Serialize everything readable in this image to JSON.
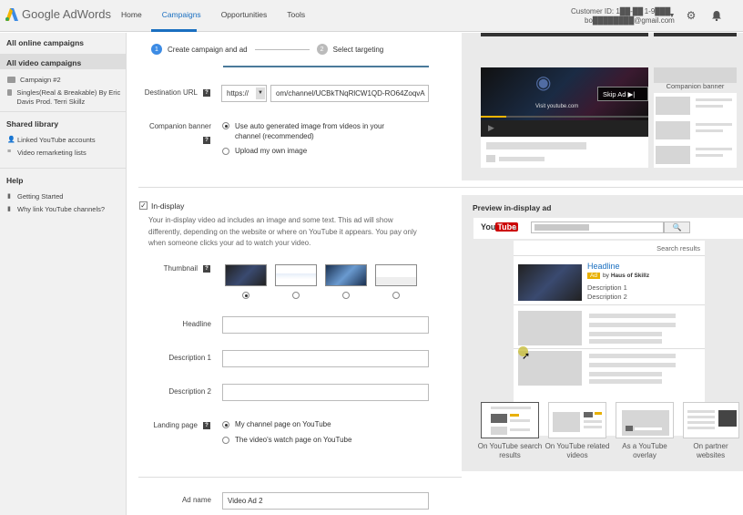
{
  "header": {
    "logo_text": "Google AdWords",
    "nav": [
      "Home",
      "Campaigns",
      "Opportunities",
      "Tools"
    ],
    "customer_id": "Customer ID: 1██-██ 1-9███",
    "account_email": "bo████████@gmail.com"
  },
  "sidebar": {
    "all_online": "All online campaigns",
    "all_video": "All video campaigns",
    "campaigns": [
      "Campaign #2",
      "Singles(Real & Breakable) By Eric Davis Prod. Terri Skillz"
    ],
    "shared_library": "Shared library",
    "library_items": [
      "Linked YouTube accounts",
      "Video remarketing lists"
    ],
    "help": "Help",
    "help_items": [
      "Getting Started",
      "Why link YouTube channels?"
    ]
  },
  "steps": {
    "step1_num": "1",
    "step1": "Create campaign and ad",
    "step2_num": "2",
    "step2": "Select targeting"
  },
  "form": {
    "destination_url_label": "Destination URL",
    "protocol": "https://",
    "url_value": "om/channel/UCBkTNqRlCW1QD-RO64ZoqvA",
    "companion_label": "Companion banner",
    "companion_opt1": "Use auto generated image from videos in your channel (recommended)",
    "companion_opt2": "Upload my own image",
    "indisplay_label": "In-display",
    "indisplay_desc": "Your in-display video ad includes an image and some text. This ad will show differently, depending on the website or where on YouTube it appears. You pay only when someone clicks your ad to watch your video.",
    "thumbnail_label": "Thumbnail",
    "headline_label": "Headline",
    "desc1_label": "Description 1",
    "desc2_label": "Description 2",
    "landing_label": "Landing page",
    "landing_opt1": "My channel page on YouTube",
    "landing_opt2": "The video's watch page on YouTube",
    "adname_label": "Ad name",
    "adname_value": "Video Ad 2"
  },
  "preview_top": {
    "skip_ad": "Skip Ad ▶|",
    "visit_text": "Visit youtube.com",
    "companion": "Companion banner"
  },
  "preview": {
    "title": "Preview in-display ad",
    "youtube": "You",
    "tube": "Tube",
    "search_results": "Search results",
    "headline": "Headline",
    "ad_badge": "Ad",
    "by": "by",
    "channel": "Haus of Skillz",
    "desc1": "Description 1",
    "desc2": "Description 2",
    "formats": [
      "On YouTube search results",
      "On YouTube related videos",
      "As a YouTube overlay",
      "On partner websites"
    ]
  },
  "colors": {
    "accent": "#1a6fc0",
    "sidebar_bg": "#f1f1f1",
    "link": "#1a6fc0"
  }
}
